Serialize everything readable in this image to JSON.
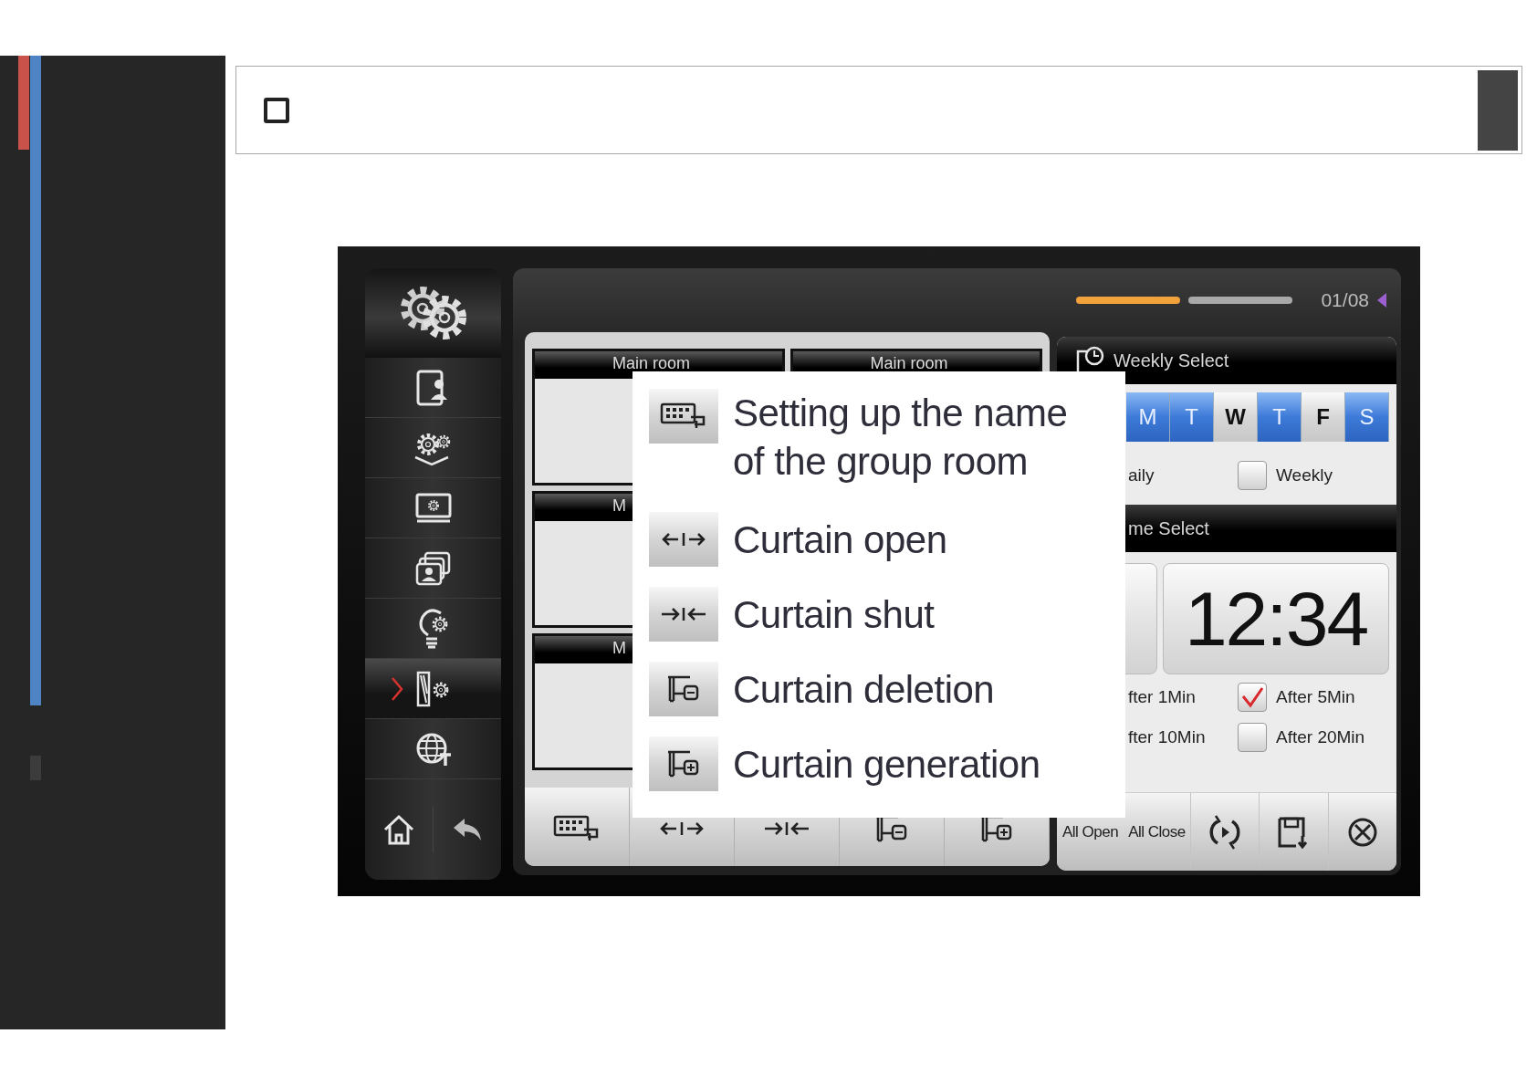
{
  "nav": [
    {
      "kind": "contact",
      "selected": false
    },
    {
      "kind": "disc",
      "selected": false
    },
    {
      "kind": "monitor",
      "selected": false
    },
    {
      "kind": "photos",
      "selected": false
    },
    {
      "kind": "bulb",
      "selected": false
    },
    {
      "kind": "curtain",
      "selected": true
    },
    {
      "kind": "globe",
      "selected": false
    }
  ],
  "pager": {
    "pages": [
      {
        "selected": true
      },
      {
        "selected": false
      }
    ],
    "counter": "01/08"
  },
  "rooms": [
    [
      {
        "title": "Main room"
      },
      {
        "title": "Main room"
      }
    ],
    [
      {
        "title": "M"
      }
    ],
    [
      {
        "title": "M"
      }
    ]
  ],
  "room_toolbar": [
    {
      "kind": "rename"
    },
    {
      "kind": "open"
    },
    {
      "kind": "shut"
    },
    {
      "kind": "delete"
    },
    {
      "kind": "add"
    }
  ],
  "weekly": {
    "title": "Weekly Select",
    "days": [
      {
        "label": "M",
        "selected": true
      },
      {
        "label": "T",
        "selected": true
      },
      {
        "label": "W",
        "selected": false
      },
      {
        "label": "T",
        "selected": true
      },
      {
        "label": "F",
        "selected": false
      },
      {
        "label": "S",
        "selected": true
      }
    ],
    "repeat": [
      {
        "label": "aily"
      },
      {
        "label": "Weekly",
        "checked": false
      }
    ]
  },
  "time": {
    "title": "me Select",
    "clock": "12:34",
    "delays": [
      {
        "label": "fter 1Min"
      },
      {
        "label": "After 5Min",
        "checked": true
      },
      {
        "label": "fter 10Min"
      },
      {
        "label": "After 20Min",
        "checked": false
      }
    ]
  },
  "actions": [
    {
      "kind": "text",
      "label": "All Open"
    },
    {
      "kind": "text",
      "label": "All Close"
    },
    {
      "kind": "refresh"
    },
    {
      "kind": "save"
    },
    {
      "kind": "close"
    }
  ],
  "legend": [
    {
      "kind": "rename",
      "text": "Setting up the name of the group room"
    },
    {
      "kind": "open",
      "text": "Curtain open"
    },
    {
      "kind": "shut",
      "text": "Curtain shut"
    },
    {
      "kind": "delete",
      "text": "Curtain deletion"
    },
    {
      "kind": "add",
      "text": "Curtain generation"
    }
  ]
}
